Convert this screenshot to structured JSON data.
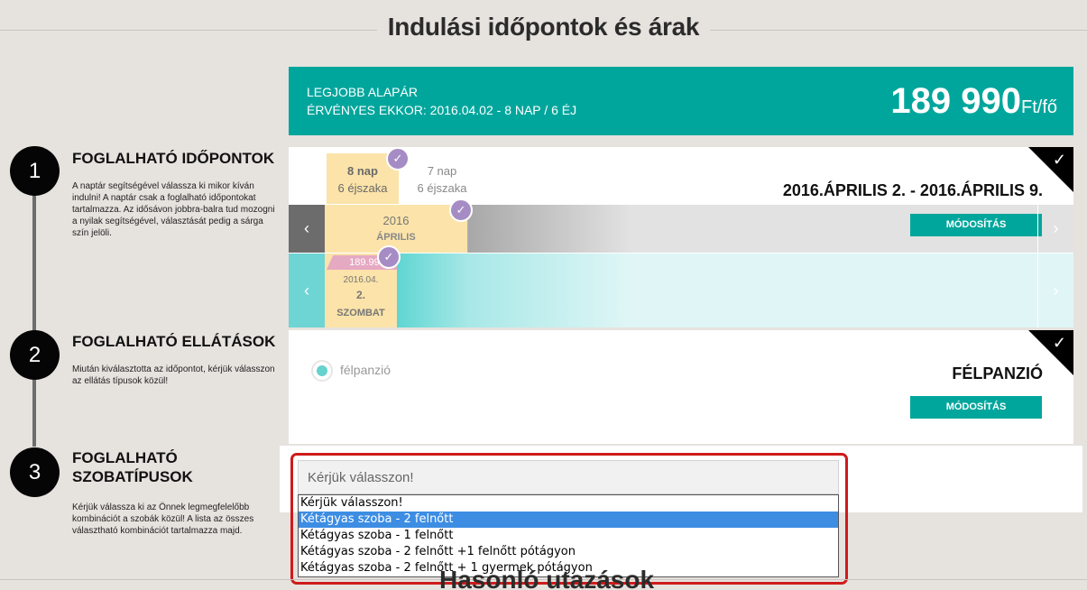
{
  "page_title": "Indulási időpontok és árak",
  "price_banner": {
    "line1": "LEGJOBB ALAPÁR",
    "line2": "ÉRVÉNYES EKKOR: 2016.04.02 - 8 NAP / 6 ÉJ",
    "price": "189 990",
    "unit": "Ft/fő"
  },
  "steps": [
    {
      "number": "1",
      "title_line1": "FOGLALHATÓ IDŐPONTOK",
      "description": "A naptár segítségével válassza ki mikor kíván indulni! A naptár csak a foglalható időpontokat tartalmazza. Az idősávon jobbra-balra tud mozogni a nyilak segítségével, választását pedig a sárga szín jelöli."
    },
    {
      "number": "2",
      "title_line1": "FOGLALHATÓ ELLÁTÁSOK",
      "description": "Miután kiválasztotta az időpontot, kérjük válasszon az ellátás típusok közül!"
    },
    {
      "number": "3",
      "title_line1": "FOGLALHATÓ",
      "title_line2": "SZOBATÍPUSOK",
      "description": "Kérjük válassza ki az Önnek legmegfelelőbb kombinációt a szobák közül! A lista az összes választható kombinációt tartalmazza majd."
    }
  ],
  "dates_panel": {
    "nights": [
      {
        "days": "8 nap",
        "nights": "6 éjszaka",
        "selected": true
      },
      {
        "days": "7 nap",
        "nights": "6 éjszaka",
        "selected": false
      }
    ],
    "summary": "2016.ÁPRILIS 2. - 2016.ÁPRILIS 9.",
    "month": {
      "year": "2016",
      "name": "ÁPRILIS"
    },
    "modify_label": "MÓDOSÍTÁS",
    "day": {
      "price": "189.990",
      "date": "2016.04.",
      "day_num": "2.",
      "weekday": "SZOMBAT"
    },
    "arrow_left": "‹",
    "arrow_right": "›",
    "check": "✓"
  },
  "board_panel": {
    "option": "félpanzió",
    "summary": "FÉLPANZIÓ",
    "modify_label": "MÓDOSÍTÁS"
  },
  "room_select": {
    "placeholder": "Kérjük válasszon!",
    "options": [
      "Kérjük válasszon!",
      "Kétágyas szoba - 2 felnőtt",
      "Kétágyas szoba - 1 felnőtt",
      "Kétágyas szoba - 2 felnőtt +1 felnőtt pótágyon",
      "Kétágyas szoba - 2 felnőtt + 1 gyermek pótágyon"
    ],
    "highlighted_index": 1
  },
  "bottom_title": "Hasonló utazások",
  "colors": {
    "accent": "#00a69c",
    "selected": "#fbe3a9",
    "check": "#a68cc4",
    "frame": "#cf1b1b"
  }
}
